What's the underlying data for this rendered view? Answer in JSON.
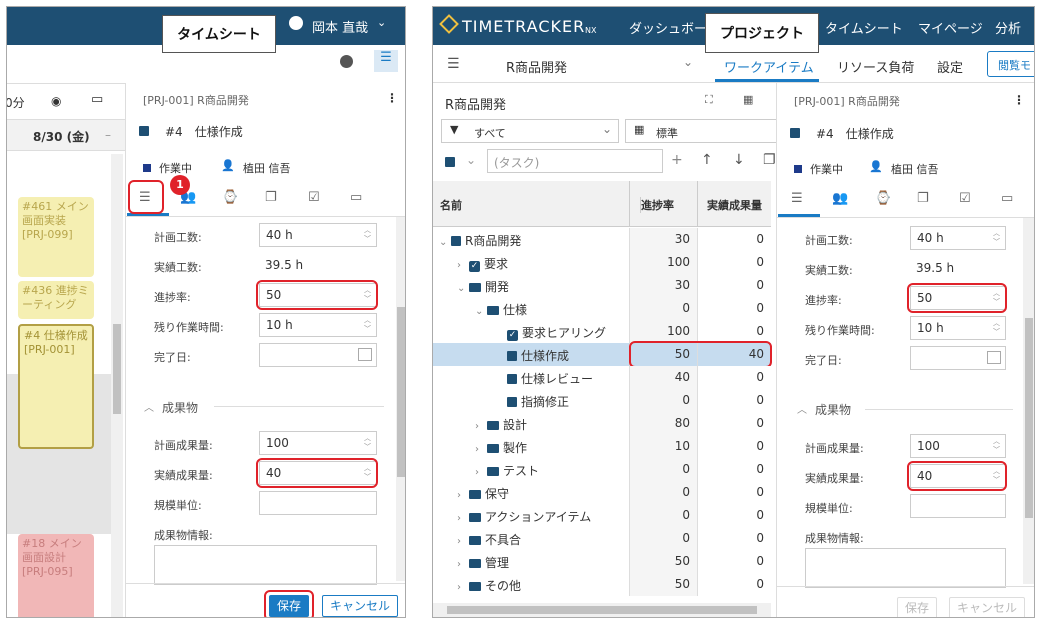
{
  "left": {
    "caption": "タイムシート",
    "user": "岡本 直哉",
    "minutes_frag": "0分",
    "date_header": "8/30 (金)",
    "events": [
      "#461 メイン画面実装 [PRJ-099]",
      "#436 進捗ミーティング",
      "#4 仕様作成 [PRJ-001]",
      "#18 メイン画面設計 [PRJ-095]"
    ],
    "detail": {
      "project": "[PRJ-001] R商品開発",
      "title": "#4　仕様作成",
      "status": "作業中",
      "assignee": "植田 信吾",
      "badge": "1",
      "fields": [
        {
          "label": "計画工数:",
          "value": "40 h"
        },
        {
          "label": "実績工数:",
          "value": "39.5 h"
        },
        {
          "label": "進捗率:",
          "value": "50"
        },
        {
          "label": "残り作業時間:",
          "value": "10 h"
        },
        {
          "label": "完了日:",
          "value": ""
        }
      ],
      "section": "成果物",
      "fields2": [
        {
          "label": "計画成果量:",
          "value": "100"
        },
        {
          "label": "実績成果量:",
          "value": "40"
        },
        {
          "label": "規模単位:",
          "value": ""
        },
        {
          "label": "成果物情報:",
          "value": ""
        }
      ],
      "save": "保存",
      "cancel": "キャンセル"
    }
  },
  "right": {
    "caption": "プロジェクト",
    "logo": "TIMETRACKER",
    "logo_sub": "NX",
    "nav": [
      "ダッシュボード",
      "タイムシート",
      "マイページ",
      "分析"
    ],
    "project_select": "R商品開発",
    "tabs": [
      "ワークアイテム",
      "リソース負荷",
      "設定"
    ],
    "view_mode": "閲覧モ",
    "tree_title": "R商品開発",
    "filter": "すべて",
    "view": "標準",
    "task_placeholder": "(タスク)",
    "columns": [
      "名前",
      "進捗率",
      "実績成果量"
    ],
    "rows": [
      {
        "name": "R商品開発",
        "p": "30",
        "a": "0"
      },
      {
        "name": "要求",
        "p": "100",
        "a": "0"
      },
      {
        "name": "開発",
        "p": "30",
        "a": "0"
      },
      {
        "name": "仕様",
        "p": "0",
        "a": "0"
      },
      {
        "name": "要求ヒアリング",
        "p": "100",
        "a": "0"
      },
      {
        "name": "仕様作成",
        "p": "50",
        "a": "40"
      },
      {
        "name": "仕様レビュー",
        "p": "40",
        "a": "0"
      },
      {
        "name": "指摘修正",
        "p": "0",
        "a": "0"
      },
      {
        "name": "設計",
        "p": "80",
        "a": "0"
      },
      {
        "name": "製作",
        "p": "10",
        "a": "0"
      },
      {
        "name": "テスト",
        "p": "0",
        "a": "0"
      },
      {
        "name": "保守",
        "p": "0",
        "a": "0"
      },
      {
        "name": "アクションアイテム",
        "p": "0",
        "a": "0"
      },
      {
        "name": "不具合",
        "p": "0",
        "a": "0"
      },
      {
        "name": "管理",
        "p": "50",
        "a": "0"
      },
      {
        "name": "その他",
        "p": "50",
        "a": "0"
      }
    ],
    "detail": {
      "project": "[PRJ-001] R商品開発",
      "title": "#4　仕様作成",
      "status": "作業中",
      "assignee": "植田 信吾",
      "fields": [
        {
          "label": "計画工数:",
          "value": "40 h"
        },
        {
          "label": "実績工数:",
          "value": "39.5 h"
        },
        {
          "label": "進捗率:",
          "value": "50"
        },
        {
          "label": "残り作業時間:",
          "value": "10 h"
        },
        {
          "label": "完了日:",
          "value": ""
        }
      ],
      "section": "成果物",
      "fields2": [
        {
          "label": "計画成果量:",
          "value": "100"
        },
        {
          "label": "実績成果量:",
          "value": "40"
        },
        {
          "label": "規模単位:",
          "value": ""
        },
        {
          "label": "成果物情報:",
          "value": ""
        }
      ],
      "save": "保存",
      "cancel": "キャンセル"
    }
  },
  "colors": {
    "header": "#1e4f73",
    "accent": "#1a7bc4",
    "highlight": "#e0222a"
  }
}
